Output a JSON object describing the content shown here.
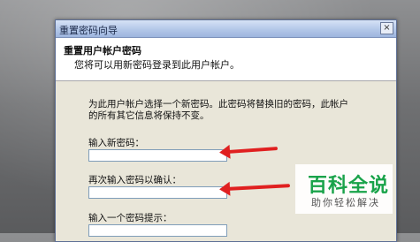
{
  "window": {
    "title": "重置密码向导",
    "close_glyph": "×"
  },
  "header": {
    "title": "重置用户帐户密码",
    "subtitle": "您将可以用新密码登录到此用户帐户。"
  },
  "body": {
    "description": "为此用户帐户选择一个新密码。此密码将替换旧的密码，此帐户的所有其它信息将保持不变。",
    "fields": [
      {
        "label": "输入新密码：",
        "value": ""
      },
      {
        "label": "再次输入密码以确认：",
        "value": ""
      },
      {
        "label": "输入一个密码提示：",
        "value": ""
      }
    ]
  },
  "annotations": {
    "arrow_color": "#e02020"
  },
  "watermark": {
    "title": "百科全说",
    "subtitle": "助你轻松解决"
  }
}
